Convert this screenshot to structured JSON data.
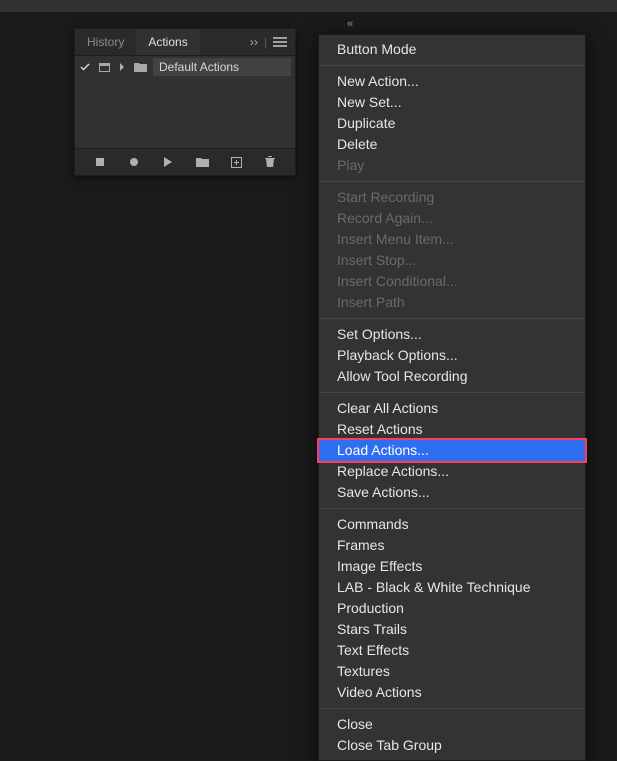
{
  "collapse_glyph": "‹‹",
  "panel": {
    "tabs": {
      "history": "History",
      "actions": "Actions"
    },
    "expand_glyph": "››",
    "row": {
      "label": "Default Actions"
    }
  },
  "menu": {
    "items": [
      {
        "label": "Button Mode",
        "disabled": false,
        "highlight": false
      },
      null,
      {
        "label": "New Action...",
        "disabled": false,
        "highlight": false
      },
      {
        "label": "New Set...",
        "disabled": false,
        "highlight": false
      },
      {
        "label": "Duplicate",
        "disabled": false,
        "highlight": false
      },
      {
        "label": "Delete",
        "disabled": false,
        "highlight": false
      },
      {
        "label": "Play",
        "disabled": true,
        "highlight": false
      },
      null,
      {
        "label": "Start Recording",
        "disabled": true,
        "highlight": false
      },
      {
        "label": "Record Again...",
        "disabled": true,
        "highlight": false
      },
      {
        "label": "Insert Menu Item...",
        "disabled": true,
        "highlight": false
      },
      {
        "label": "Insert Stop...",
        "disabled": true,
        "highlight": false
      },
      {
        "label": "Insert Conditional...",
        "disabled": true,
        "highlight": false
      },
      {
        "label": "Insert Path",
        "disabled": true,
        "highlight": false
      },
      null,
      {
        "label": "Set Options...",
        "disabled": false,
        "highlight": false
      },
      {
        "label": "Playback Options...",
        "disabled": false,
        "highlight": false
      },
      {
        "label": "Allow Tool Recording",
        "disabled": false,
        "highlight": false
      },
      null,
      {
        "label": "Clear All Actions",
        "disabled": false,
        "highlight": false
      },
      {
        "label": "Reset Actions",
        "disabled": false,
        "highlight": false
      },
      {
        "label": "Load Actions...",
        "disabled": false,
        "highlight": true
      },
      {
        "label": "Replace Actions...",
        "disabled": false,
        "highlight": false
      },
      {
        "label": "Save Actions...",
        "disabled": false,
        "highlight": false
      },
      null,
      {
        "label": "Commands",
        "disabled": false,
        "highlight": false
      },
      {
        "label": "Frames",
        "disabled": false,
        "highlight": false
      },
      {
        "label": "Image Effects",
        "disabled": false,
        "highlight": false
      },
      {
        "label": "LAB - Black & White Technique",
        "disabled": false,
        "highlight": false
      },
      {
        "label": "Production",
        "disabled": false,
        "highlight": false
      },
      {
        "label": "Stars Trails",
        "disabled": false,
        "highlight": false
      },
      {
        "label": "Text Effects",
        "disabled": false,
        "highlight": false
      },
      {
        "label": "Textures",
        "disabled": false,
        "highlight": false
      },
      {
        "label": "Video Actions",
        "disabled": false,
        "highlight": false
      },
      null,
      {
        "label": "Close",
        "disabled": false,
        "highlight": false
      },
      {
        "label": "Close Tab Group",
        "disabled": false,
        "highlight": false
      }
    ]
  }
}
